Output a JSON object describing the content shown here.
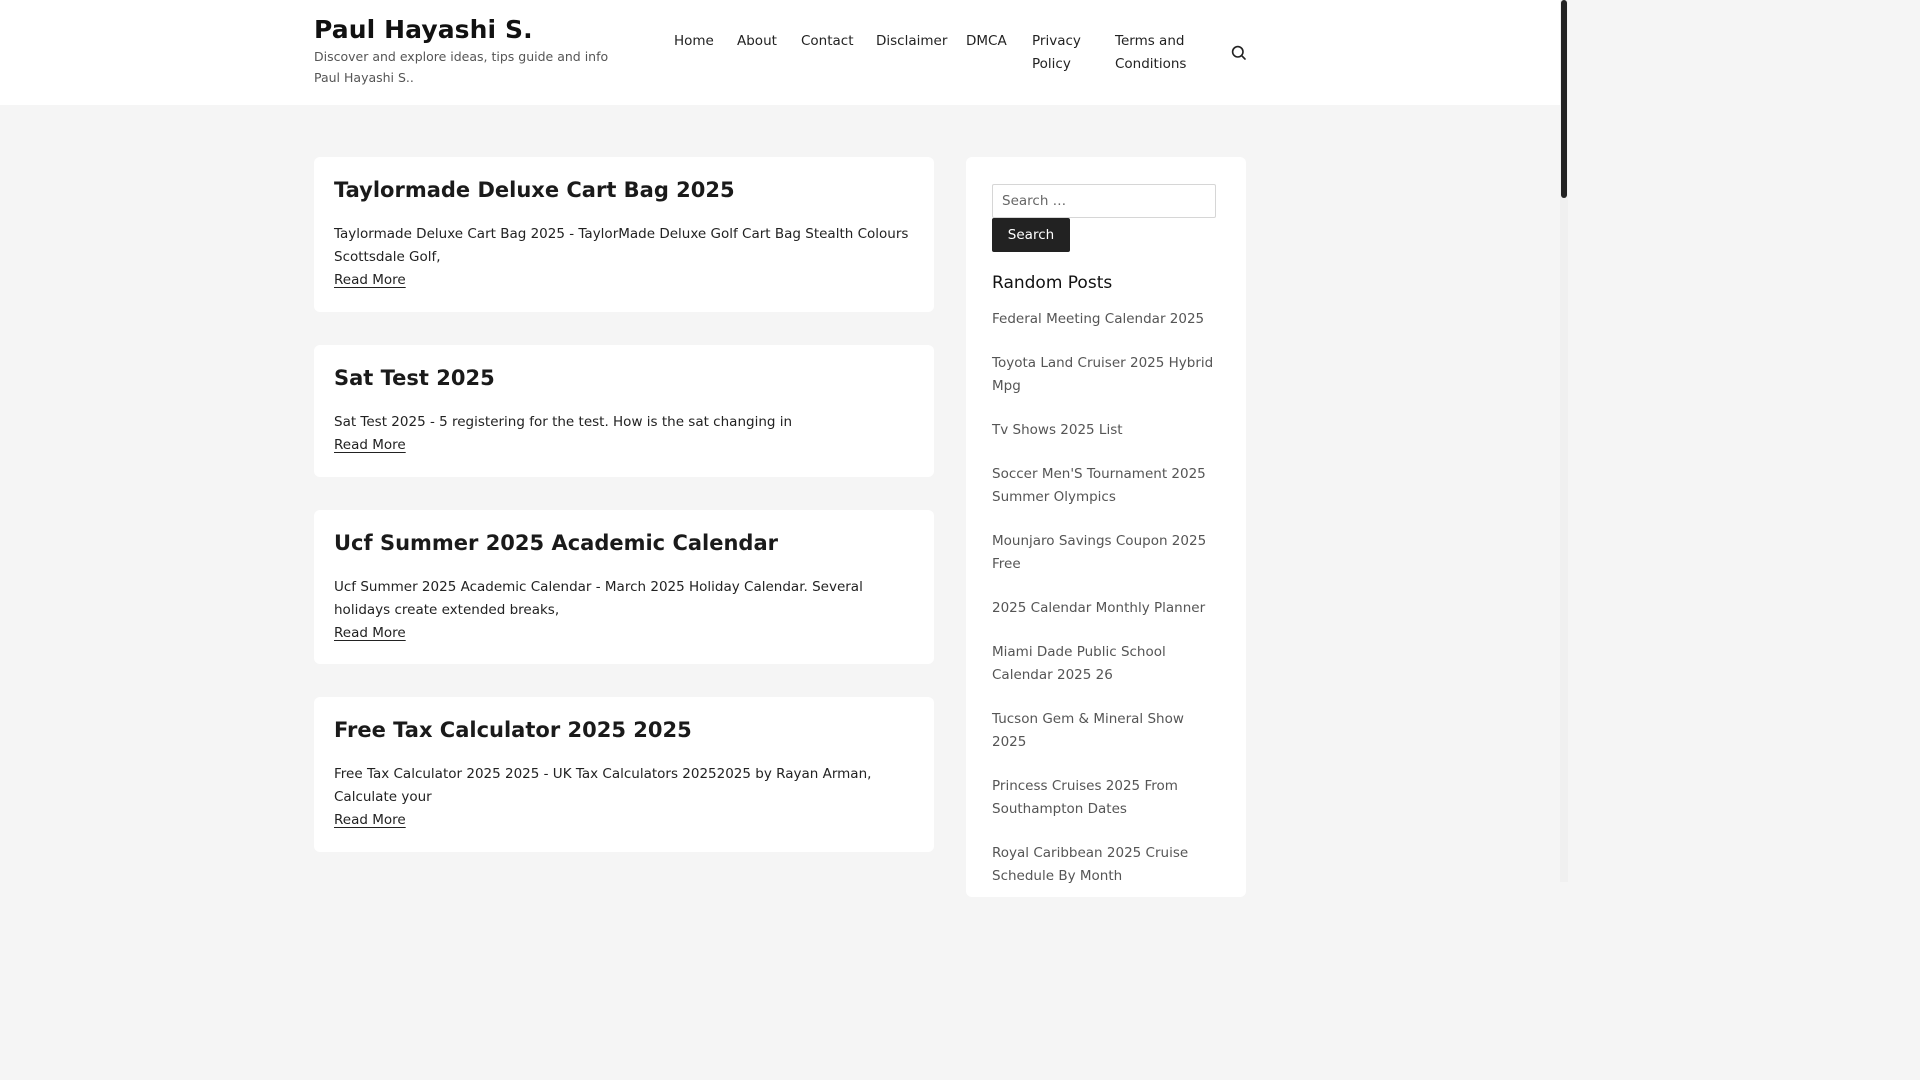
{
  "header": {
    "site_title": "Paul Hayashi S.",
    "site_description": "Discover and explore ideas, tips guide and info Paul Hayashi S..",
    "nav": [
      {
        "label": "Home"
      },
      {
        "label": "About"
      },
      {
        "label": "Contact"
      },
      {
        "label": "Disclaimer"
      },
      {
        "label": "DMCA"
      },
      {
        "label": "Privacy Policy"
      },
      {
        "label": "Terms and Conditions"
      }
    ],
    "search_icon": "search-icon"
  },
  "posts": [
    {
      "title": "Taylormade Deluxe Cart Bag 2025",
      "excerpt": "Taylormade Deluxe Cart Bag 2025 - TaylorMade Deluxe Golf Cart Bag Stealth Colours Scottsdale Golf,",
      "read_more": "Read More"
    },
    {
      "title": "Sat Test 2025",
      "excerpt": "Sat Test 2025 - 5 registering for the test. How is the sat changing in",
      "read_more": "Read More"
    },
    {
      "title": "Ucf Summer 2025 Academic Calendar",
      "excerpt": "Ucf Summer 2025 Academic Calendar - March 2025 Holiday Calendar. Several holidays create extended breaks,",
      "read_more": "Read More"
    },
    {
      "title": "Free Tax Calculator 2025 2025",
      "excerpt": "Free Tax Calculator 2025 2025 - UK Tax Calculators 20252025 by Rayan Arman, Calculate your",
      "read_more": "Read More"
    }
  ],
  "sidebar": {
    "search": {
      "placeholder": "Search …",
      "value": "",
      "button_label": "Search"
    },
    "widget_title": "Random Posts",
    "random_posts": [
      "Federal Meeting Calendar 2025",
      "Toyota Land Cruiser 2025 Hybrid Mpg",
      "Tv Shows 2025 List",
      "Soccer Men'S Tournament 2025 Summer Olympics",
      "Mounjaro Savings Coupon 2025 Free",
      "2025 Calendar Monthly Planner",
      "Miami Dade Public School Calendar 2025 26",
      "Tucson Gem & Mineral Show 2025",
      "Princess Cruises 2025 From Southampton Dates",
      "Royal Caribbean 2025 Cruise Schedule By Month"
    ]
  },
  "colors": {
    "page_background": "#f5f5f5",
    "card_background": "#ffffff",
    "button_background": "#222222",
    "link_muted": "#555555"
  }
}
